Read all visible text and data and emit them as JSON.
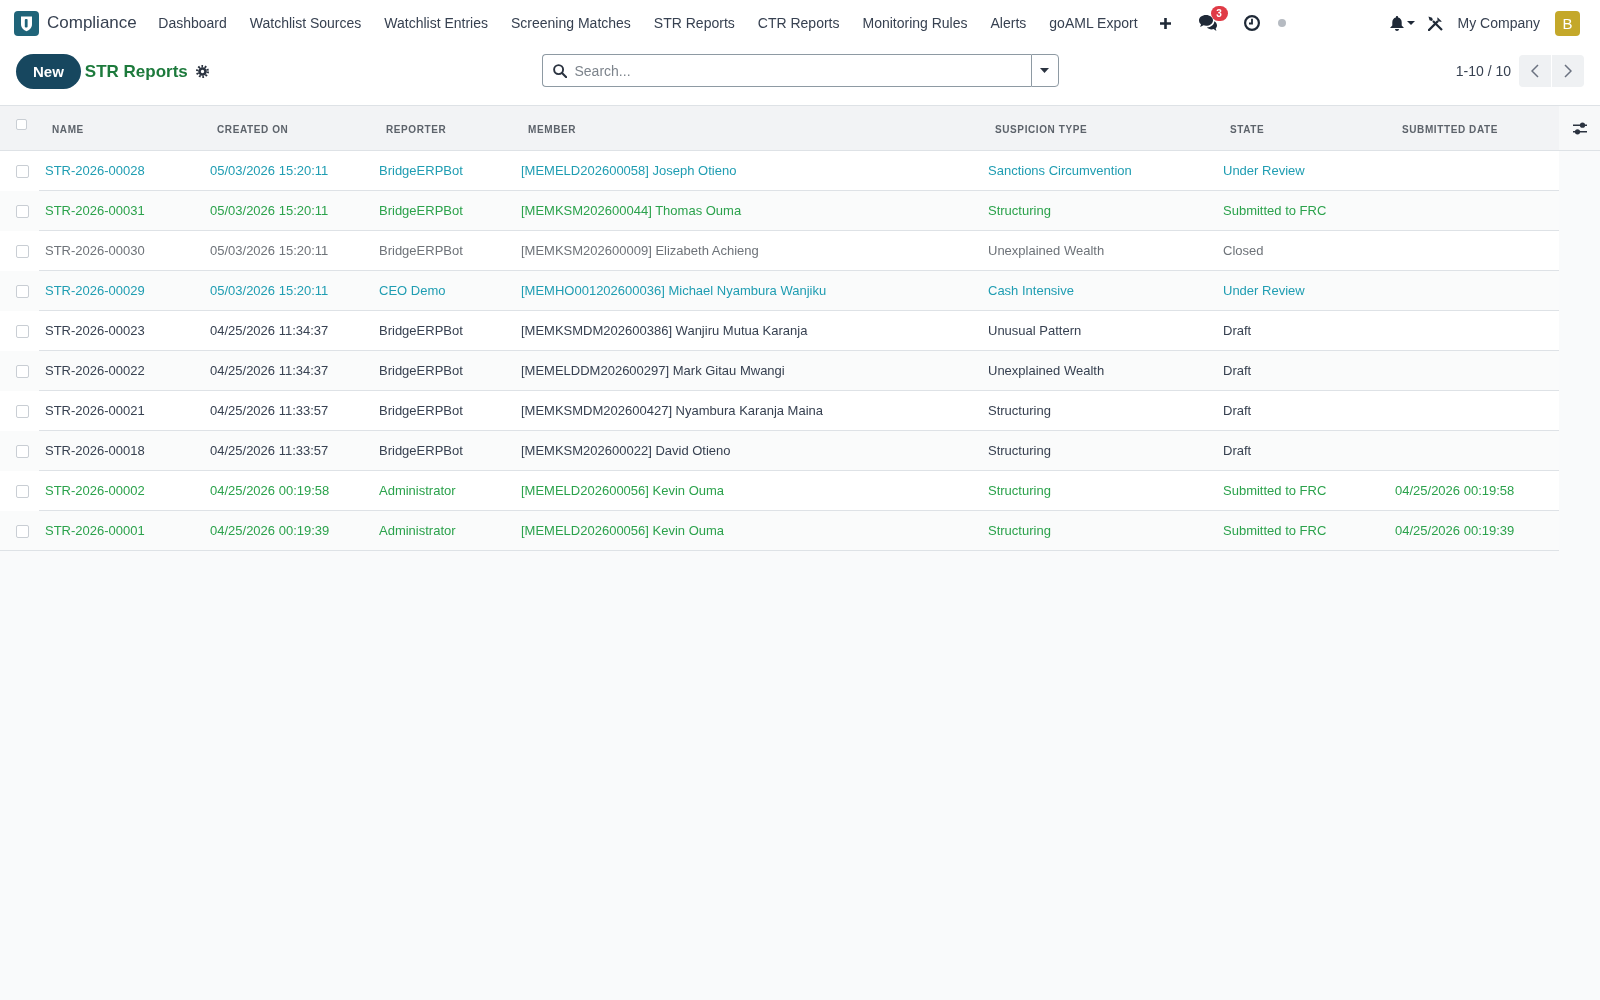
{
  "navbar": {
    "app_name": "Compliance",
    "menu": [
      "Dashboard",
      "Watchlist Sources",
      "Watchlist Entries",
      "Screening Matches",
      "STR Reports",
      "CTR Reports",
      "Monitoring Rules",
      "Alerts",
      "goAML Export"
    ],
    "unread_messages": "3",
    "company": "My Company",
    "avatar_letter": "B"
  },
  "control_panel": {
    "new_button": "New",
    "title": "STR Reports",
    "search": {
      "placeholder": "Search..."
    },
    "pager": "1-10 / 10"
  },
  "table": {
    "select_all_checked": false,
    "columns": [
      "NAME",
      "CREATED ON",
      "REPORTER",
      "MEMBER",
      "SUSPICION TYPE",
      "STATE",
      "SUBMITTED DATE"
    ],
    "rows": [
      {
        "kind": "info",
        "checked": false,
        "name": "STR-2026-00028",
        "created_on": "05/03/2026 15:20:11",
        "reporter": "BridgeERPBot",
        "member": "[MEMELD202600058] Joseph Otieno",
        "suspicion_type": "Sanctions Circumvention",
        "state": "Under Review"
      },
      {
        "kind": "success",
        "checked": false,
        "name": "STR-2026-00031",
        "created_on": "05/03/2026 15:20:11",
        "reporter": "BridgeERPBot",
        "member": "[MEMKSM202600044] Thomas Ouma",
        "suspicion_type": "Structuring",
        "state": "Submitted to FRC"
      },
      {
        "kind": "muted",
        "checked": false,
        "name": "STR-2026-00030",
        "created_on": "05/03/2026 15:20:11",
        "reporter": "BridgeERPBot",
        "member": "[MEMKSM202600009] Elizabeth Achieng",
        "suspicion_type": "Unexplained Wealth",
        "state": "Closed"
      },
      {
        "kind": "info",
        "checked": false,
        "name": "STR-2026-00029",
        "created_on": "05/03/2026 15:20:11",
        "reporter": "CEO Demo",
        "member": "[MEMHO001202600036] Michael Nyambura Wanjiku",
        "suspicion_type": "Cash Intensive",
        "state": "Under Review"
      },
      {
        "kind": "plain",
        "checked": false,
        "name": "STR-2026-00023",
        "created_on": "04/25/2026 11:34:37",
        "reporter": "BridgeERPBot",
        "member": "[MEMKSMDM202600386] Wanjiru Mutua Karanja",
        "suspicion_type": "Unusual Pattern",
        "state": "Draft"
      },
      {
        "kind": "plain",
        "checked": false,
        "name": "STR-2026-00022",
        "created_on": "04/25/2026 11:34:37",
        "reporter": "BridgeERPBot",
        "member": "[MEMELDDM202600297] Mark Gitau Mwangi",
        "suspicion_type": "Unexplained Wealth",
        "state": "Draft"
      },
      {
        "kind": "plain",
        "checked": false,
        "name": "STR-2026-00021",
        "created_on": "04/25/2026 11:33:57",
        "reporter": "BridgeERPBot",
        "member": "[MEMKSMDM202600427] Nyambura Karanja Maina",
        "suspicion_type": "Structuring",
        "state": "Draft"
      },
      {
        "kind": "plain",
        "checked": false,
        "name": "STR-2026-00018",
        "created_on": "04/25/2026 11:33:57",
        "reporter": "BridgeERPBot",
        "member": "[MEMKSM202600022] David Otieno",
        "suspicion_type": "Structuring",
        "state": "Draft"
      },
      {
        "kind": "success",
        "checked": false,
        "name": "STR-2026-00002",
        "created_on": "04/25/2026 00:19:58",
        "reporter": "Administrator",
        "member": "[MEMELD202600056] Kevin Ouma",
        "suspicion_type": "Structuring",
        "state": "Submitted to FRC",
        "submitted_date": "04/25/2026 00:19:58"
      },
      {
        "kind": "success",
        "checked": false,
        "name": "STR-2026-00001",
        "created_on": "04/25/2026 00:19:39",
        "reporter": "Administrator",
        "member": "[MEMELD202600056] Kevin Ouma",
        "suspicion_type": "Structuring",
        "state": "Submitted to FRC",
        "submitted_date": "04/25/2026 00:19:39"
      }
    ]
  }
}
